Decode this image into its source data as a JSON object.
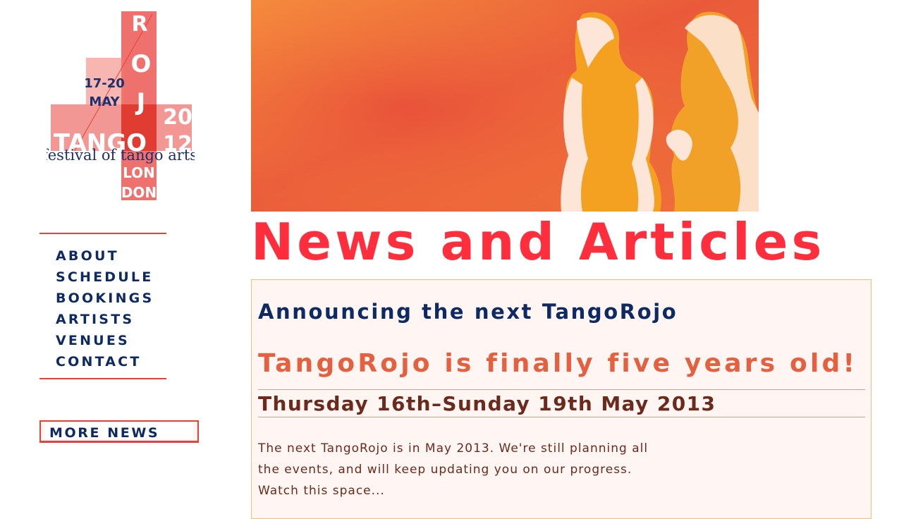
{
  "logo": {
    "letters": [
      "R",
      "O",
      "J"
    ],
    "dates": "17-20",
    "month": "MAY",
    "year_top": "20",
    "year_bottom": "12",
    "tango": "TANGO",
    "tagline": "festival of tango arts",
    "city_top": "LON",
    "city_bottom": "DON"
  },
  "nav": {
    "items": [
      {
        "label": "ABOUT"
      },
      {
        "label": "SCHEDULE"
      },
      {
        "label": "BOOKINGS"
      },
      {
        "label": "ARTISTS"
      },
      {
        "label": "VENUES"
      },
      {
        "label": "CONTACT"
      }
    ],
    "more_news": "MORE NEWS"
  },
  "page": {
    "title": "News and Articles"
  },
  "article": {
    "heading": "Announcing the next TangoRojo",
    "subheading": "TangoRojo is finally five years old!",
    "date": "Thursday 16th–Sunday 19th May 2013",
    "body": "The next TangoRojo is in May 2013. We're still planning all the events, and will keep updating you on our progress. Watch this space..."
  },
  "colors": {
    "accent_red": "#ff2e3d",
    "nav_blue": "#0d2a63",
    "subheading_orange": "#e4603f",
    "body_brown": "#6b2a1c"
  }
}
